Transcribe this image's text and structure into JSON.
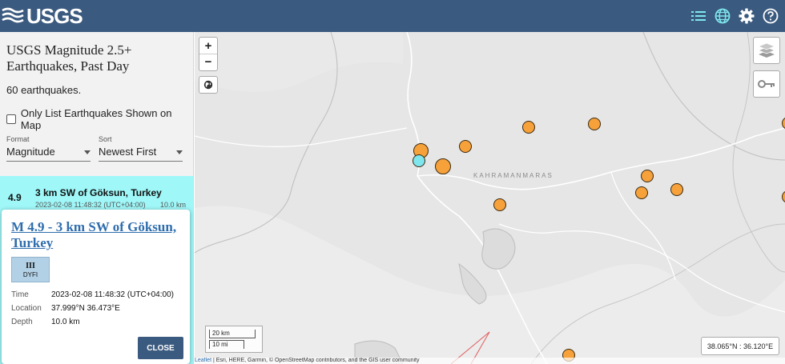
{
  "header": {
    "logo_text": "USGS",
    "icons": [
      "list-icon",
      "globe-icon",
      "gear-icon",
      "help-icon"
    ],
    "bg_color": "#3b5a7f"
  },
  "sidebar": {
    "title": "USGS Magnitude 2.5+ Earthquakes, Past Day",
    "count": "60 earthquakes.",
    "only_list_label": "Only List Earthquakes Shown on Map",
    "format_label": "Format",
    "format_value": "Magnitude",
    "sort_label": "Sort",
    "sort_value": "Newest First",
    "selected_item": {
      "magnitude": "4.9",
      "place": "3 km SW of Göksun, Turkey",
      "time": "2023-02-08 11:48:32 (UTC+04:00)",
      "depth": "10.0 km"
    }
  },
  "popup": {
    "title": "M 4.9 - 3 km SW of Göksun, Turkey",
    "dyfi_roman": "III",
    "dyfi_label": "DYFI",
    "time_label": "Time",
    "time_value": "2023-02-08 11:48:32 (UTC+04:00)",
    "location_label": "Location",
    "location_value": "37.999°N 36.473°E",
    "depth_label": "Depth",
    "depth_value": "10.0 km",
    "close_label": "CLOSE"
  },
  "map": {
    "zoom_in": "+",
    "zoom_out": "−",
    "city_label": "KAHRAMANMARAS",
    "scale_km": "20 km",
    "scale_mi": "10 mi",
    "coordinates": "38.065°N : 36.120°E",
    "attribution_link": "Leaflet",
    "attribution_text": " | Esri, HERE, Garmin, © OpenStreetMap contributors, and the GIS user community",
    "marker_color": "#f6a13a",
    "selected_marker_color": "#7ee6ec"
  }
}
